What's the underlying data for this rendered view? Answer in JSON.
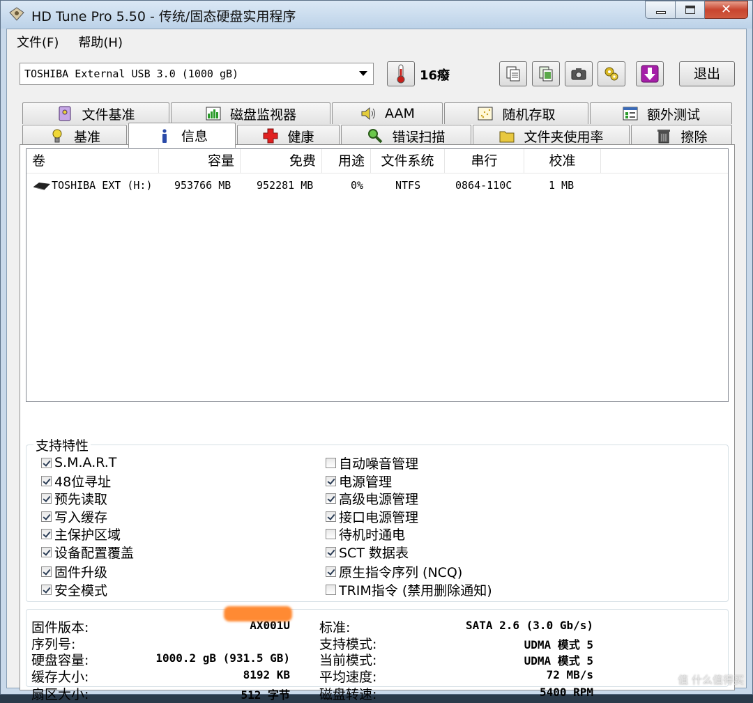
{
  "window": {
    "title": "HD Tune Pro 5.50 - 传统/固态硬盘实用程序",
    "close_glyph": "✕"
  },
  "menu": [
    "文件(F)",
    "帮助(H)"
  ],
  "toolbar": {
    "drive": "TOSHIBA External USB 3.0 (1000 gB)",
    "temperature": "16癈",
    "exit_label": "退出",
    "buttons": [
      "copy-info-icon",
      "copy-all-icon",
      "screenshot-camera-icon",
      "options-icon",
      "save-down-icon"
    ]
  },
  "tabs_top": [
    {
      "label": "文件基准",
      "icon": "file-benchmark-icon"
    },
    {
      "label": "磁盘监视器",
      "icon": "disk-monitor-icon"
    },
    {
      "label": "AAM",
      "icon": "speaker-icon"
    },
    {
      "label": "随机存取",
      "icon": "random-access-icon"
    },
    {
      "label": "额外测试",
      "icon": "extra-tests-icon"
    }
  ],
  "tabs_bottom": [
    {
      "label": "基准",
      "icon": "lightbulb-icon"
    },
    {
      "label": "信息",
      "icon": "info-icon",
      "active": true
    },
    {
      "label": "健康",
      "icon": "health-cross-icon"
    },
    {
      "label": "错误扫描",
      "icon": "magnifier-icon"
    },
    {
      "label": "文件夹使用率",
      "icon": "folder-icon"
    },
    {
      "label": "擦除",
      "icon": "trash-icon"
    }
  ],
  "volumes": {
    "columns": [
      "卷",
      "容量",
      "免费",
      "用途",
      "文件系统",
      "串行",
      "校准"
    ],
    "rows": [
      {
        "volume": "TOSHIBA EXT (H:)",
        "capacity": "953766 MB",
        "free": "952281 MB",
        "usage": "0%",
        "fs": "NTFS",
        "serial": "0864-110C",
        "cluster": "1 MB"
      }
    ]
  },
  "features": {
    "title": "支持特性",
    "left": [
      {
        "label": "S.M.A.R.T",
        "checked": true
      },
      {
        "label": "48位寻址",
        "checked": true
      },
      {
        "label": "预先读取",
        "checked": true
      },
      {
        "label": "写入缓存",
        "checked": true
      },
      {
        "label": "主保护区域",
        "checked": true
      },
      {
        "label": "设备配置覆盖",
        "checked": true
      },
      {
        "label": "固件升级",
        "checked": true
      },
      {
        "label": "安全模式",
        "checked": true
      }
    ],
    "right": [
      {
        "label": "自动噪音管理",
        "checked": false
      },
      {
        "label": "电源管理",
        "checked": true
      },
      {
        "label": "高级电源管理",
        "checked": true
      },
      {
        "label": "接口电源管理",
        "checked": true
      },
      {
        "label": "待机时通电",
        "checked": false
      },
      {
        "label": "SCT 数据表",
        "checked": true
      },
      {
        "label": "原生指令序列 (NCQ)",
        "checked": true
      },
      {
        "label": "TRIM指令 (禁用删除通知)",
        "checked": false
      }
    ]
  },
  "details": {
    "left": [
      {
        "label": "固件版本:",
        "value": "AX001U"
      },
      {
        "label": "序列号:",
        "value": ""
      },
      {
        "label": "硬盘容量:",
        "value": "1000.2 gB (931.5 GB)"
      },
      {
        "label": "缓存大小:",
        "value": "8192 KB"
      },
      {
        "label": "扇区大小:",
        "value": "512 字节"
      }
    ],
    "right": [
      {
        "label": "标准:",
        "value": "SATA 2.6 (3.0 Gb/s)"
      },
      {
        "label": "支持模式:",
        "value": "UDMA 模式 5"
      },
      {
        "label": "当前模式:",
        "value": "UDMA 模式 5"
      },
      {
        "label": "平均速度:",
        "value": "72 MB/s"
      },
      {
        "label": "磁盘转速:",
        "value": "5400 RPM"
      }
    ]
  },
  "watermark": "值 什么值得买"
}
